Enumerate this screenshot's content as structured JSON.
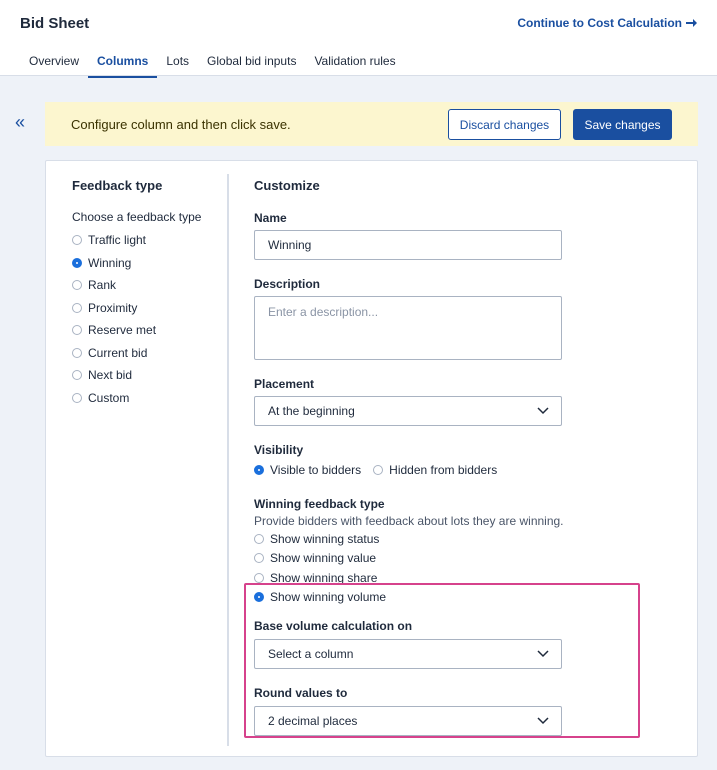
{
  "header": {
    "title": "Bid Sheet",
    "continue_label": "Continue to Cost Calculation",
    "tabs": [
      "Overview",
      "Columns",
      "Lots",
      "Global bid inputs",
      "Validation rules"
    ],
    "active_tab": "Columns"
  },
  "collapse_icon": "«",
  "banner": {
    "message": "Configure column and then click save.",
    "discard_label": "Discard changes",
    "save_label": "Save changes",
    "background": "#fcf6cf"
  },
  "feedback": {
    "title": "Feedback type",
    "choose_label": "Choose a feedback type",
    "options": [
      "Traffic light",
      "Winning",
      "Rank",
      "Proximity",
      "Reserve met",
      "Current bid",
      "Next bid",
      "Custom"
    ],
    "selected": "Winning"
  },
  "customize": {
    "title": "Customize",
    "name_label": "Name",
    "name_value": "Winning",
    "description_label": "Description",
    "description_placeholder": "Enter a description...",
    "placement_label": "Placement",
    "placement_value": "At the beginning",
    "visibility_label": "Visibility",
    "visibility_options": [
      "Visible to bidders",
      "Hidden from bidders"
    ],
    "visibility_selected": "Visible to bidders",
    "winning_type_label": "Winning feedback type",
    "winning_type_help": "Provide bidders with feedback about lots they are winning.",
    "winning_type_options": [
      "Show winning status",
      "Show winning value",
      "Show winning share",
      "Show winning volume"
    ],
    "winning_type_selected": "Show winning volume",
    "base_volume_label": "Base volume calculation on",
    "base_volume_value": "Select a column",
    "round_label": "Round values to",
    "round_value": "2 decimal places"
  },
  "colors": {
    "accent": "#1a4fa0",
    "radio_checked": "#1a6fdc",
    "highlight": "#d6428c"
  }
}
